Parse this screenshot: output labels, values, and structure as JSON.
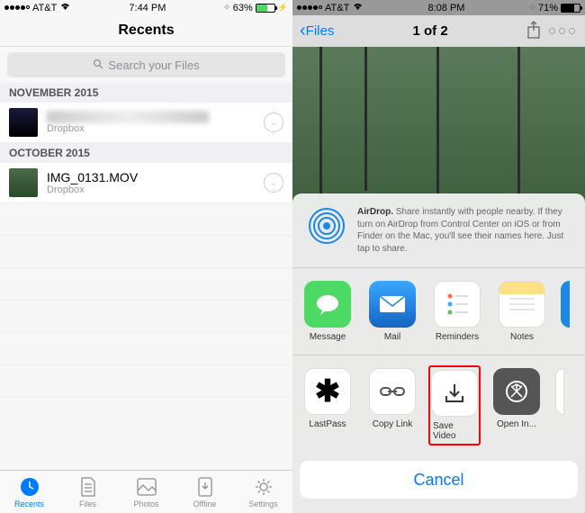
{
  "left": {
    "status": {
      "carrier": "AT&T",
      "time": "7:44 PM",
      "battery": "63%"
    },
    "title": "Recents",
    "search_placeholder": "Search your Files",
    "sections": [
      {
        "header": "NOVEMBER 2015",
        "file": "",
        "sub": "Dropbox"
      },
      {
        "header": "OCTOBER 2015",
        "file": "IMG_0131.MOV",
        "sub": "Dropbox"
      }
    ],
    "tabs": [
      {
        "label": "Recents"
      },
      {
        "label": "Files"
      },
      {
        "label": "Photos"
      },
      {
        "label": "Offline"
      },
      {
        "label": "Settings"
      }
    ]
  },
  "right": {
    "status": {
      "carrier": "AT&T",
      "time": "8:08 PM",
      "battery": "71%"
    },
    "back": "Files",
    "counter": "1 of 2",
    "airdrop_title": "AirDrop.",
    "airdrop_body": " Share instantly with people nearby. If they turn on AirDrop from Control Center on iOS or from Finder on the Mac, you'll see their names here. Just tap to share.",
    "apps_row1": [
      {
        "label": "Message",
        "color": "#4cd964",
        "icon": "message-icon"
      },
      {
        "label": "Mail",
        "color": "#1e88e5",
        "icon": "mail-icon"
      },
      {
        "label": "Reminders",
        "color": "#fff",
        "icon": "reminders-icon"
      },
      {
        "label": "Notes",
        "color": "#fff",
        "icon": "notes-icon"
      }
    ],
    "apps_row2": [
      {
        "label": "LastPass",
        "icon": "asterisk-icon"
      },
      {
        "label": "Copy Link",
        "icon": "link-icon"
      },
      {
        "label": "Save Video",
        "icon": "download-icon",
        "highlight": true
      },
      {
        "label": "Open In...",
        "icon": "openin-icon"
      }
    ],
    "cancel": "Cancel"
  }
}
